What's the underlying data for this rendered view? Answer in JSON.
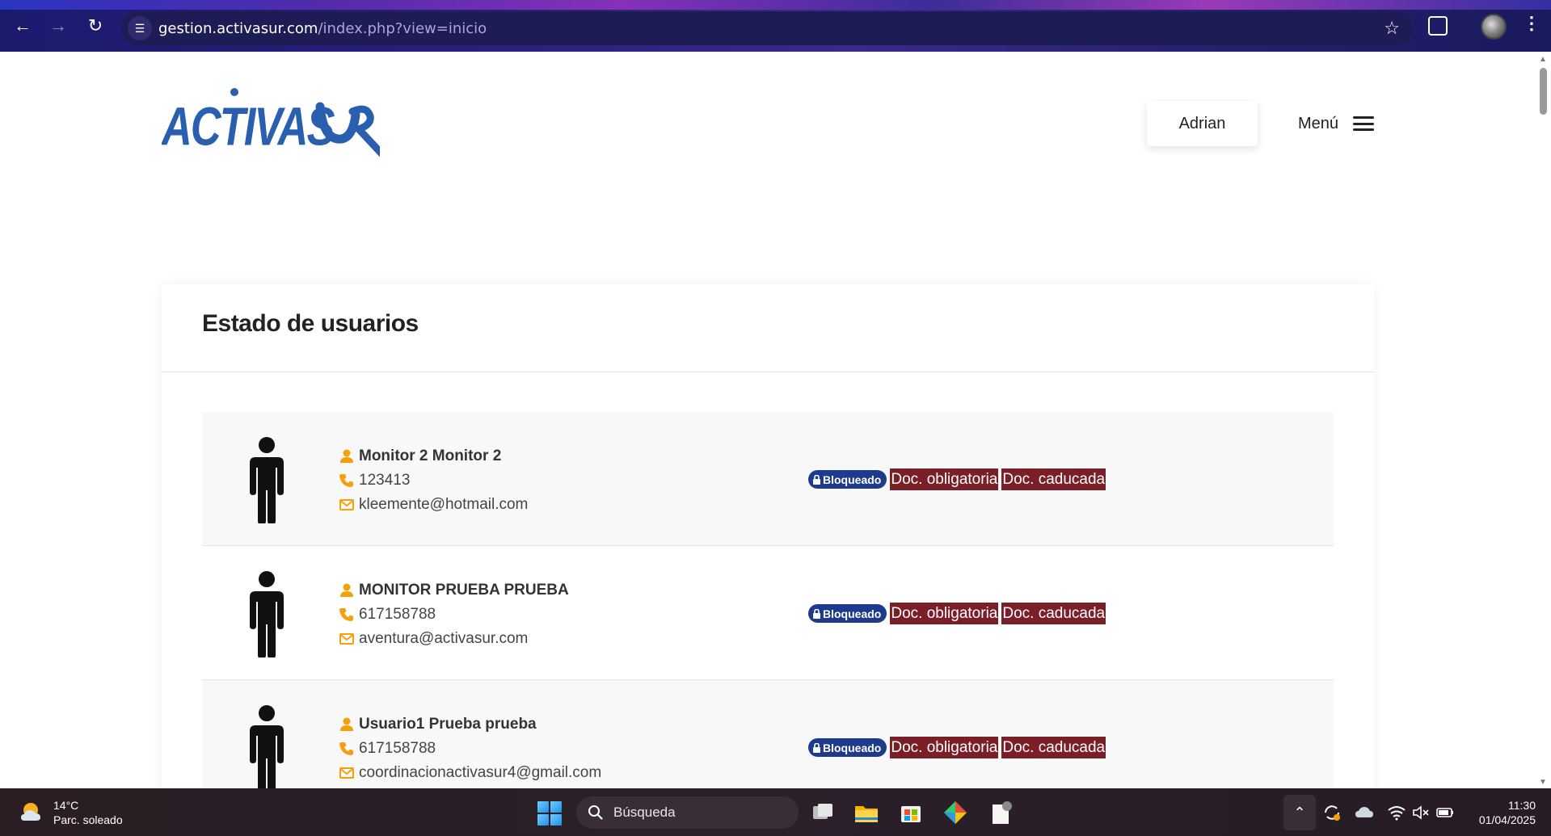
{
  "browser": {
    "url_domain": "gestion.activasur.com",
    "url_path": "/index.php?view=inicio"
  },
  "header": {
    "logo_text": "ACTIVASUR",
    "user_label": "Adrian",
    "menu_label": "Menú"
  },
  "section": {
    "title": "Estado de usuarios"
  },
  "users": [
    {
      "name": "Monitor 2 Monitor 2",
      "phone": "123413",
      "email": "kleemente@hotmail.com",
      "status_badge": "Bloqueado",
      "doc_badges": [
        "Doc. obligatoria",
        "Doc. caducada"
      ]
    },
    {
      "name": "MONITOR PRUEBA PRUEBA",
      "phone": "617158788",
      "email": "aventura@activasur.com",
      "status_badge": "Bloqueado",
      "doc_badges": [
        "Doc. obligatoria",
        "Doc. caducada"
      ]
    },
    {
      "name": "Usuario1 Prueba prueba",
      "phone": "617158788",
      "email": "coordinacionactivasur4@gmail.com",
      "status_badge": "Bloqueado",
      "doc_badges": [
        "Doc. obligatoria",
        "Doc. caducada"
      ]
    }
  ],
  "taskbar": {
    "temperature": "14°C",
    "weather": "Parc. soleado",
    "search_placeholder": "Búsqueda",
    "time": "11:30",
    "date": "01/04/2025"
  },
  "colors": {
    "accent_orange": "#f5a00b",
    "badge_blue": "#1d3a8c",
    "badge_red": "#7a1f28",
    "logo_blue": "#2a5fb0"
  },
  "icons": [
    "back-icon",
    "forward-icon",
    "reload-icon",
    "site-info-icon",
    "bookmark-star-icon",
    "extensions-icon",
    "profile-avatar",
    "kebab-icon",
    "hamburger-icon",
    "person-figure-icon",
    "user-icon",
    "phone-icon",
    "envelope-icon",
    "lock-icon",
    "weather-icon",
    "windows-start-icon",
    "search-icon"
  ]
}
